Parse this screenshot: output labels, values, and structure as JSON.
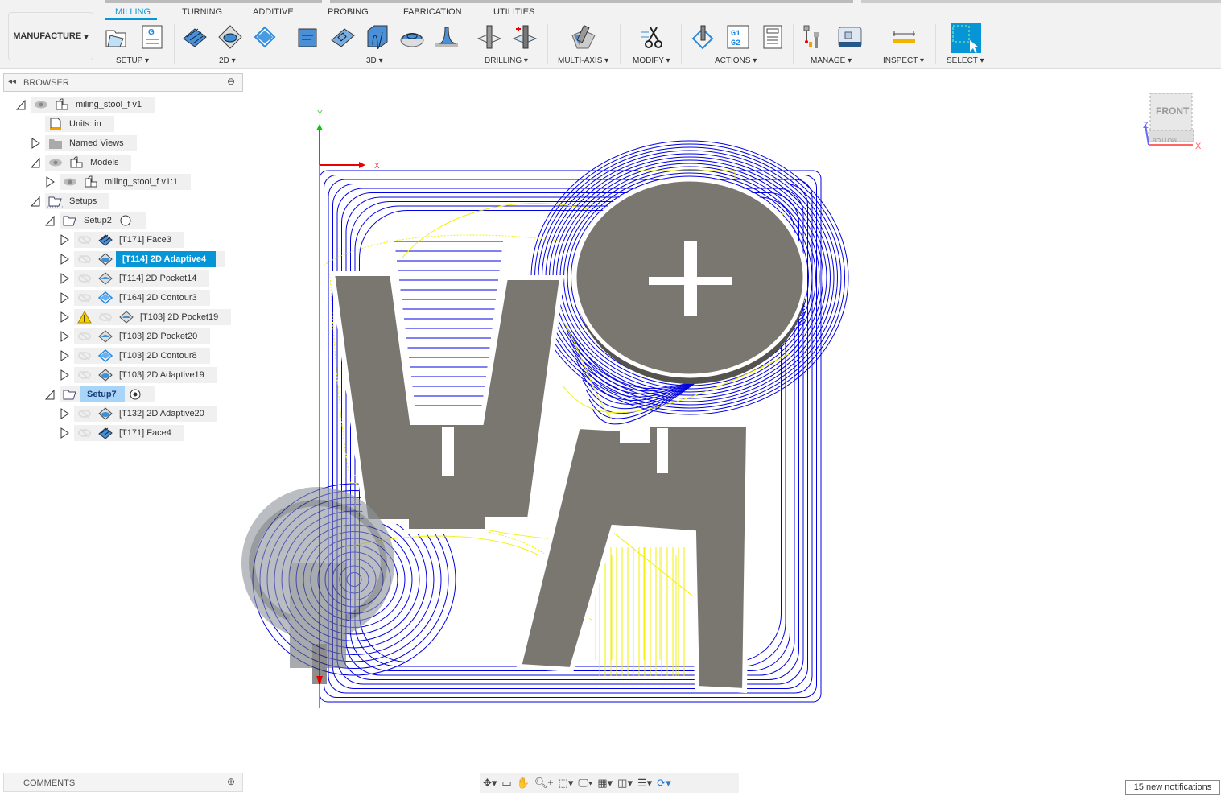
{
  "toolbar": {
    "workspace": "MANUFACTURE",
    "tabs": [
      {
        "label": "MILLING",
        "active": true
      },
      {
        "label": "TURNING"
      },
      {
        "label": "ADDITIVE"
      },
      {
        "label": "PROBING"
      },
      {
        "label": "FABRICATION"
      },
      {
        "label": "UTILITIES"
      }
    ],
    "groups": [
      "SETUP",
      "2D",
      "3D",
      "DRILLING",
      "MULTI-AXIS",
      "MODIFY",
      "ACTIONS",
      "MANAGE",
      "INSPECT",
      "SELECT"
    ],
    "accent": "#0696d7"
  },
  "browser": {
    "title": "BROWSER",
    "items": [
      {
        "label": "miling_stool_f v1",
        "level": 0,
        "expand": "open",
        "eye": true,
        "icon": "component-icon"
      },
      {
        "label": "Units: in",
        "level": 1,
        "expand": "none",
        "icon": "units-icon"
      },
      {
        "label": "Named Views",
        "level": 1,
        "expand": "closed",
        "icon": "folder-icon"
      },
      {
        "label": "Models",
        "level": 1,
        "expand": "open",
        "eye": true,
        "icon": "component-icon"
      },
      {
        "label": "miling_stool_f v1:1",
        "level": 2,
        "expand": "closed",
        "eye": true,
        "icon": "component-icon"
      },
      {
        "label": "Setups",
        "level": 1,
        "expand": "open",
        "icon": "setups-icon"
      },
      {
        "label": "Setup2",
        "level": 2,
        "expand": "open",
        "icon": "setup-icon",
        "radio": "off"
      },
      {
        "label": "[T171] Face3",
        "level": 3,
        "expand": "closed",
        "hidden": true,
        "icon": "face-op-icon"
      },
      {
        "label": "[T114] 2D Adaptive4",
        "level": 3,
        "expand": "closed",
        "hidden": true,
        "icon": "adaptive-op-icon",
        "selected": true
      },
      {
        "label": "[T114] 2D Pocket14",
        "level": 3,
        "expand": "closed",
        "hidden": true,
        "icon": "pocket-op-icon"
      },
      {
        "label": "[T164] 2D Contour3",
        "level": 3,
        "expand": "closed",
        "hidden": true,
        "icon": "contour-op-icon"
      },
      {
        "label": "[T103] 2D Pocket19",
        "level": 3,
        "expand": "closed",
        "hidden": true,
        "icon": "pocket-op-icon",
        "warning": true
      },
      {
        "label": "[T103] 2D Pocket20",
        "level": 3,
        "expand": "closed",
        "hidden": true,
        "icon": "pocket-op-icon"
      },
      {
        "label": "[T103] 2D Contour8",
        "level": 3,
        "expand": "closed",
        "hidden": true,
        "icon": "contour-op-icon"
      },
      {
        "label": "[T103] 2D Adaptive19",
        "level": 3,
        "expand": "closed",
        "hidden": true,
        "icon": "adaptive-op-icon"
      },
      {
        "label": "Setup7",
        "level": 2,
        "expand": "open",
        "icon": "setup-icon",
        "radio": "on",
        "active": true
      },
      {
        "label": "[T132] 2D Adaptive20",
        "level": 3,
        "expand": "closed",
        "hidden": true,
        "icon": "adaptive-op-icon"
      },
      {
        "label": "[T171] Face4",
        "level": 3,
        "expand": "closed",
        "hidden": true,
        "icon": "face-op-icon"
      }
    ]
  },
  "comments": {
    "title": "COMMENTS"
  },
  "viewport": {
    "axis_x": "X",
    "axis_y": "Y",
    "viewcube_face": "FRONT",
    "viewcube_bottom": "BOTTOM",
    "viewcube_z": "Z",
    "viewcube_x": "X",
    "toolpath_color": "#0000e0",
    "link_color": "#f0f000",
    "model_color": "#7a7770"
  },
  "navbar": {
    "icons": [
      "orbit-icon",
      "look-at-icon",
      "pan-icon",
      "zoom-icon",
      "zoom-window-icon",
      "display-settings-icon",
      "grid-icon",
      "viewports-icon",
      "layers-icon",
      "refresh-icon"
    ]
  },
  "status": {
    "notifications": "15 new notifications"
  }
}
